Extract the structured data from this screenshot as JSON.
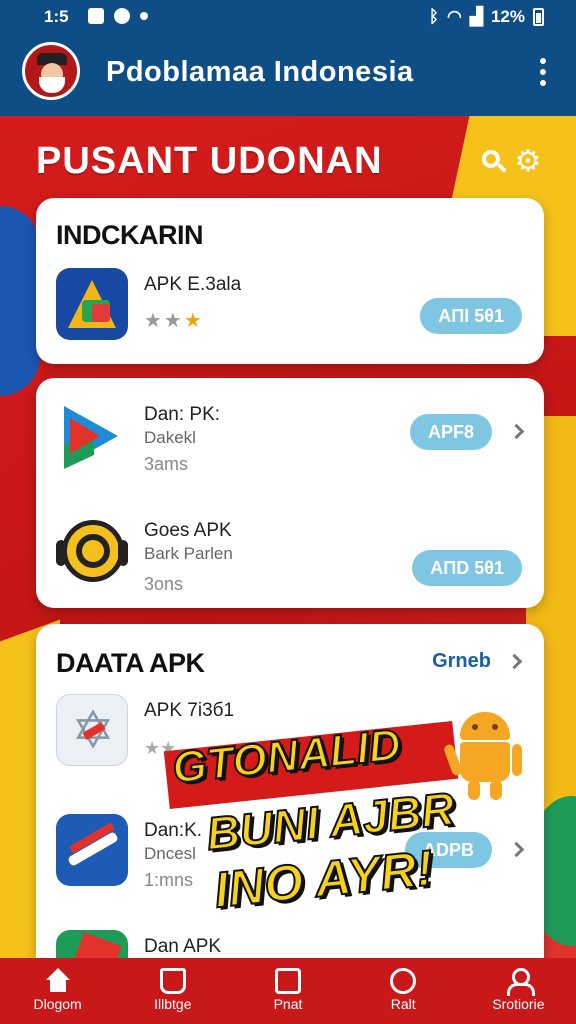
{
  "status_bar": {
    "time": "1:5",
    "battery": "12%",
    "icons": [
      "notification-icon",
      "notification-icon",
      "signal-dot-icon",
      "bluetooth-icon",
      "wifi-icon",
      "cell-signal-icon",
      "battery-icon"
    ]
  },
  "app_bar": {
    "title": "Pdoblamaa Indonesia",
    "menu_icon": "more-vert-icon",
    "colors": {
      "bar": "#0f4d86"
    }
  },
  "hero": {
    "headline": "PUSANT UDONAN",
    "icons": [
      "search-icon",
      "gear-icon"
    ],
    "colors": {
      "red": "#c41818",
      "yellow": "#f6c21a"
    }
  },
  "card1": {
    "section_title": "INDCKARIN",
    "rows": [
      {
        "name": "APK E.3ala",
        "button": "AΠΙ 5θ1",
        "stars_filled": 2,
        "stars_half": 1
      }
    ]
  },
  "card2": {
    "rows": [
      {
        "name": "Dan: PK:",
        "subtitle": "Dakekl",
        "meta": "3ams",
        "button": "APF8"
      },
      {
        "name": "Goes APK",
        "subtitle": "Bark Parlen",
        "meta": "3ons",
        "button": "AΠD 5θ1"
      }
    ]
  },
  "card3": {
    "section_title": "DAATA APK",
    "more_label": "Grneb",
    "rows": [
      {
        "name": "APK 7і3б1",
        "meta": "★★"
      },
      {
        "name": "Dan:K.",
        "subtitle": "Dncesl",
        "meta": "1:mns",
        "button": "ADPB"
      },
      {
        "name": "Dan APK"
      }
    ]
  },
  "promo": {
    "line1": "GTONALID",
    "line2": "BUNI AJBR",
    "line3": "INO AYR!"
  },
  "bottom_nav": {
    "items": [
      {
        "label": "Dlogom",
        "icon": "home-icon"
      },
      {
        "label": "Illbtge",
        "icon": "cart-icon"
      },
      {
        "label": "Pnat",
        "icon": "bag-icon"
      },
      {
        "label": "Ralt",
        "icon": "clock-icon"
      },
      {
        "label": "Srotiorie",
        "icon": "user-icon"
      }
    ]
  }
}
